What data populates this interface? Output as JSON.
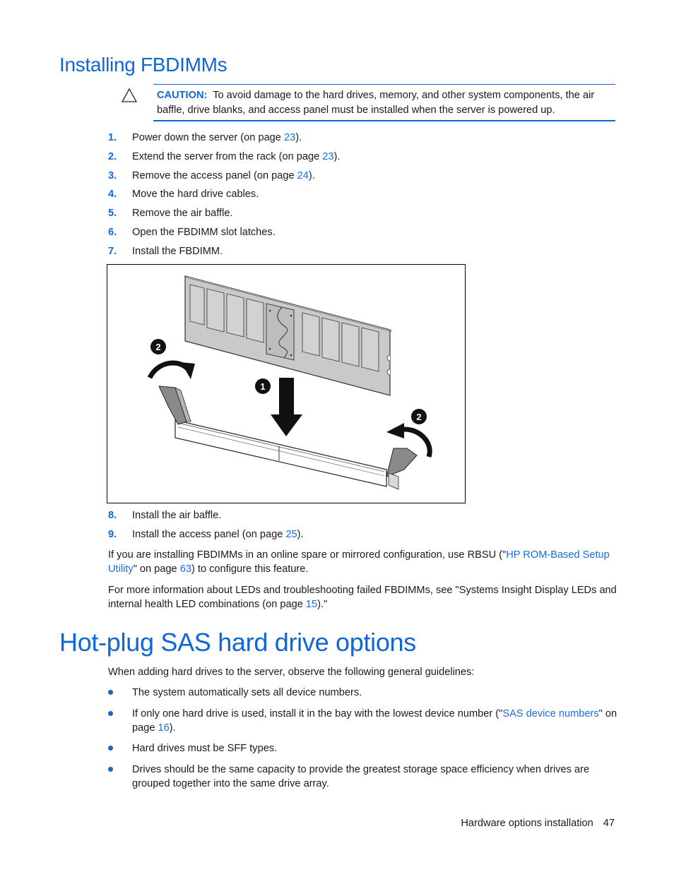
{
  "section1": {
    "title": "Installing FBDIMMs",
    "caution": {
      "label": "CAUTION:",
      "text": "To avoid damage to the hard drives, memory, and other system components, the air baffle, drive blanks, and access panel must be installed when the server is powered up."
    },
    "steps": [
      {
        "num": "1.",
        "text": "Power down the server (on page ",
        "link": "23",
        "after": ")."
      },
      {
        "num": "2.",
        "text": "Extend the server from the rack (on page ",
        "link": "23",
        "after": ")."
      },
      {
        "num": "3.",
        "text": "Remove the access panel (on page ",
        "link": "24",
        "after": ")."
      },
      {
        "num": "4.",
        "text": "Move the hard drive cables."
      },
      {
        "num": "5.",
        "text": "Remove the air baffle."
      },
      {
        "num": "6.",
        "text": "Open the FBDIMM slot latches."
      },
      {
        "num": "7.",
        "text": "Install the FBDIMM."
      },
      {
        "num": "8.",
        "text": "Install the air baffle."
      },
      {
        "num": "9.",
        "text": "Install the access panel (on page ",
        "link": "25",
        "after": ")."
      }
    ],
    "figure": {
      "callouts": [
        "1",
        "2",
        "2"
      ]
    },
    "para1": {
      "pre": "If you are installing FBDIMMs in an online spare or mirrored configuration, use RBSU (\"",
      "link1": "HP ROM-Based Setup Utility",
      "mid": "\" on page ",
      "link2": "63",
      "post": ") to configure this feature."
    },
    "para2": {
      "pre": "For more information about LEDs and troubleshooting failed FBDIMMs, see \"Systems Insight Display LEDs and internal health LED combinations (on page ",
      "link": "15",
      "post": ").\""
    }
  },
  "section2": {
    "title": "Hot-plug SAS hard drive options",
    "intro": "When adding hard drives to the server, observe the following general guidelines:",
    "bullets": [
      {
        "text": "The system automatically sets all device numbers."
      },
      {
        "pre": "If only one hard drive is used, install it in the bay with the lowest device number (\"",
        "link1": "SAS device numbers",
        "mid": "\" on page ",
        "link2": "16",
        "post": ")."
      },
      {
        "text": "Hard drives must be SFF types."
      },
      {
        "text": "Drives should be the same capacity to provide the greatest storage space efficiency when drives are grouped together into the same drive array."
      }
    ]
  },
  "footer": {
    "chapter": "Hardware options installation",
    "page": "47"
  }
}
